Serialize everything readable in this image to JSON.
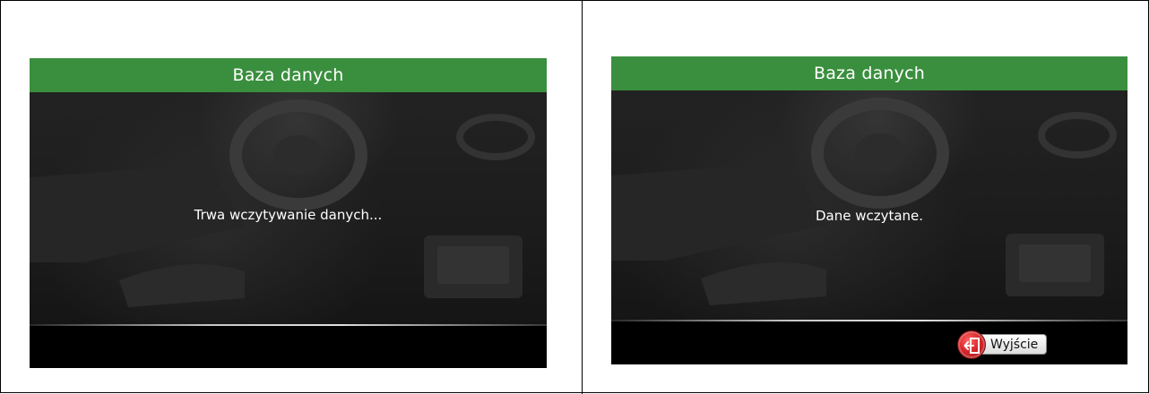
{
  "screens": [
    {
      "title": "Baza danych",
      "message": "Trwa wczytywanie danych..."
    },
    {
      "title": "Baza danych",
      "message": "Dane wczytane.",
      "exit_button": {
        "label": "Wyjście",
        "icon": "exit-door-icon"
      }
    }
  ],
  "colors": {
    "title_bar": "#3a8f3e",
    "background": "#1c1c1c",
    "bottom_bar": "#000000",
    "exit_icon": "#d8262b"
  }
}
